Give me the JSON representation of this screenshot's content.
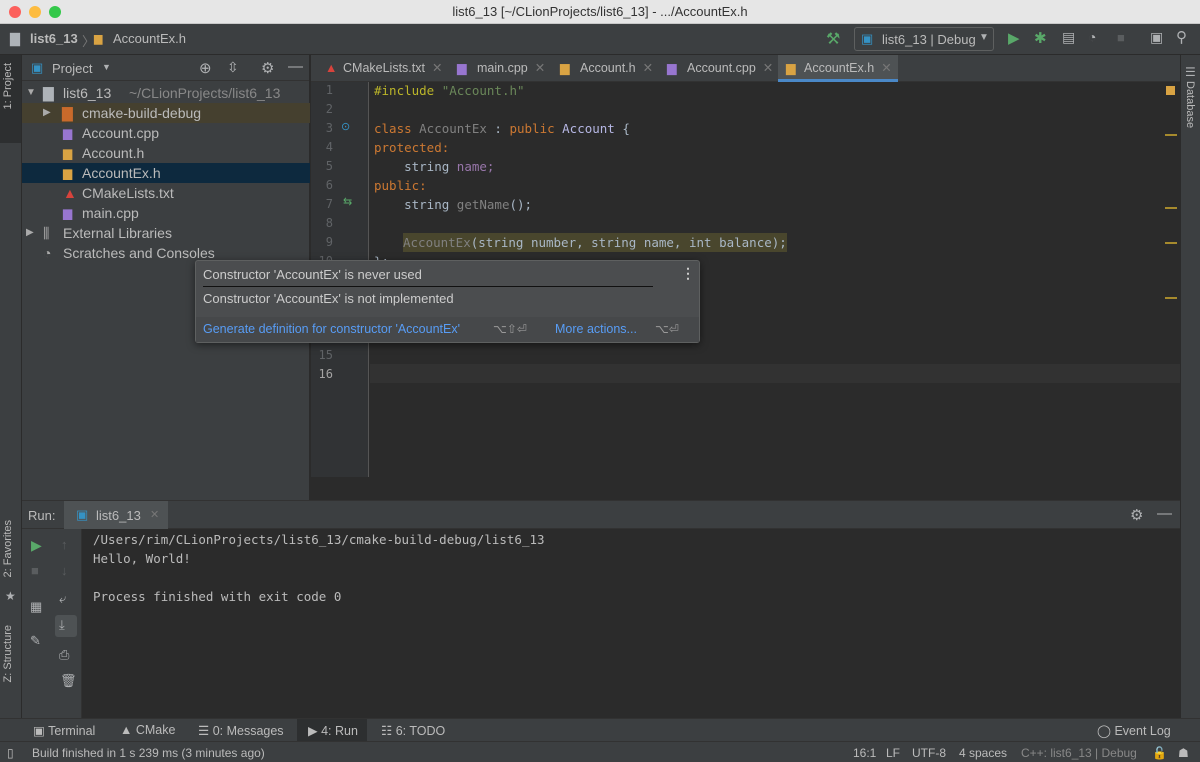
{
  "window": {
    "title": "list6_13 [~/CLionProjects/list6_13] - .../AccountEx.h"
  },
  "navbar": {
    "project": "list6_13",
    "file": "AccountEx.h",
    "run_config": "list6_13 | Debug"
  },
  "project_panel": {
    "title": "Project",
    "items": [
      {
        "label": "list6_13",
        "extra": "~/CLionProjects/list6_13",
        "type": "folder"
      },
      {
        "label": "cmake-build-debug",
        "type": "build-folder"
      },
      {
        "label": "Account.cpp",
        "type": "cpp"
      },
      {
        "label": "Account.h",
        "type": "h"
      },
      {
        "label": "AccountEx.h",
        "type": "h",
        "selected": true
      },
      {
        "label": "CMakeLists.txt",
        "type": "cmake"
      },
      {
        "label": "main.cpp",
        "type": "cpp"
      },
      {
        "label": "External Libraries",
        "type": "lib"
      },
      {
        "label": "Scratches and Consoles",
        "type": "scratch"
      }
    ]
  },
  "tabs": [
    {
      "label": "CMakeLists.txt"
    },
    {
      "label": "main.cpp"
    },
    {
      "label": "Account.h"
    },
    {
      "label": "Account.cpp"
    },
    {
      "label": "AccountEx.h",
      "active": true
    }
  ],
  "editor": {
    "line_numbers": [
      "1",
      "2",
      "3",
      "4",
      "5",
      "6",
      "7",
      "8",
      "9",
      "10",
      "15",
      "16"
    ],
    "lines": {
      "l1a": "#include ",
      "l1b": "\"Account.h\"",
      "l3a": "class ",
      "l3b": "AccountEx",
      " l3c": "",
      "l3d": " : ",
      "l3e": "public ",
      "l3f": "Account",
      " l3g": "",
      "l3h": " {",
      "l4": "protected:",
      "l5a": "    string ",
      "l5b": "name;",
      "l6": "public:",
      "l7a": "    string ",
      "l7b": "getName",
      "l7c": "();",
      "l9a": "AccountEx",
      "l9b": "(string number",
      ", l9c": "",
      "l9": "(string number, string name, int balance);",
      "l10": "};"
    }
  },
  "popup": {
    "line1": "Constructor 'AccountEx' is never used",
    "line2": "Constructor 'AccountEx' is not implemented",
    "action": "Generate definition for constructor 'AccountEx'",
    "action_shortcut": "⌥⇧⏎",
    "more": "More actions...",
    "more_shortcut": "⌥⏎"
  },
  "run_panel": {
    "label": "Run:",
    "tab": "list6_13",
    "output": [
      "/Users/rim/CLionProjects/list6_13/cmake-build-debug/list6_13",
      "Hello, World!",
      "",
      "Process finished with exit code 0"
    ]
  },
  "side_tabs": {
    "project": "1: Project",
    "favorites": "2: Favorites",
    "structure": "Z: Structure",
    "database": "Database"
  },
  "tool_windows": [
    {
      "label": "Terminal"
    },
    {
      "label": "CMake"
    },
    {
      "label": "0: Messages"
    },
    {
      "label": "4: Run",
      "active": true
    },
    {
      "label": "6: TODO"
    }
  ],
  "event_log": "Event Log",
  "status": {
    "message": "Build finished in 1 s 239 ms (3 minutes ago)",
    "position": "16:1",
    "line_sep": "LF",
    "encoding": "UTF-8",
    "indent": "4 spaces",
    "context": "C++: list6_13 | Debug"
  }
}
